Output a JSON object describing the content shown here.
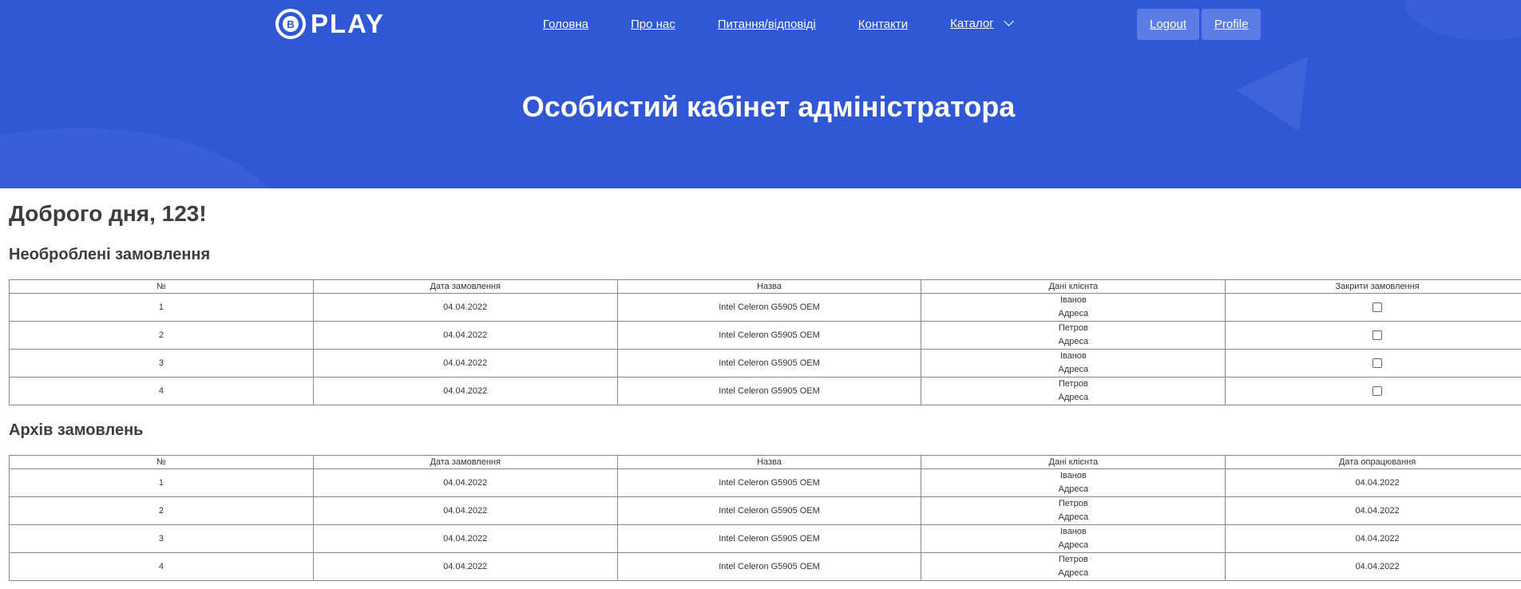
{
  "header": {
    "logo_letter": "B",
    "logo_text": "PLAY",
    "nav": [
      "Головна",
      "Про нас",
      "Питання/відповіді",
      "Контакти",
      "Каталог"
    ],
    "logout": "Logout",
    "profile": "Profile",
    "title": "Особистий кабінет адміністратора"
  },
  "greeting": "Доброго дня, 123!",
  "pending": {
    "title": "Необроблені замовлення",
    "columns": [
      "№",
      "Дата замовлення",
      "Назва",
      "Дані клієнта",
      "Закрити замовлення"
    ],
    "rows": [
      {
        "num": "1",
        "date": "04.04.2022",
        "name": "Intel Celeron G5905 OEM",
        "client": "Іванов",
        "address": "Адреса"
      },
      {
        "num": "2",
        "date": "04.04.2022",
        "name": "Intel Celeron G5905 OEM",
        "client": "Петров",
        "address": "Адреса"
      },
      {
        "num": "3",
        "date": "04.04.2022",
        "name": "Intel Celeron G5905 OEM",
        "client": "Іванов",
        "address": "Адреса"
      },
      {
        "num": "4",
        "date": "04.04.2022",
        "name": "Intel Celeron G5905 OEM",
        "client": "Петров",
        "address": "Адреса"
      }
    ]
  },
  "archive": {
    "title": "Архів замовлень",
    "columns": [
      "№",
      "Дата замовлення",
      "Назва",
      "Дані клієнта",
      "Дата опрацювання"
    ],
    "rows": [
      {
        "num": "1",
        "date": "04.04.2022",
        "name": "Intel Celeron G5905 OEM",
        "client": "Іванов",
        "address": "Адреса",
        "processed": "04.04.2022"
      },
      {
        "num": "2",
        "date": "04.04.2022",
        "name": "Intel Celeron G5905 OEM",
        "client": "Петров",
        "address": "Адреса",
        "processed": "04.04.2022"
      },
      {
        "num": "3",
        "date": "04.04.2022",
        "name": "Intel Celeron G5905 OEM",
        "client": "Іванов",
        "address": "Адреса",
        "processed": "04.04.2022"
      },
      {
        "num": "4",
        "date": "04.04.2022",
        "name": "Intel Celeron G5905 OEM",
        "client": "Петров",
        "address": "Адреса",
        "processed": "04.04.2022"
      }
    ]
  }
}
